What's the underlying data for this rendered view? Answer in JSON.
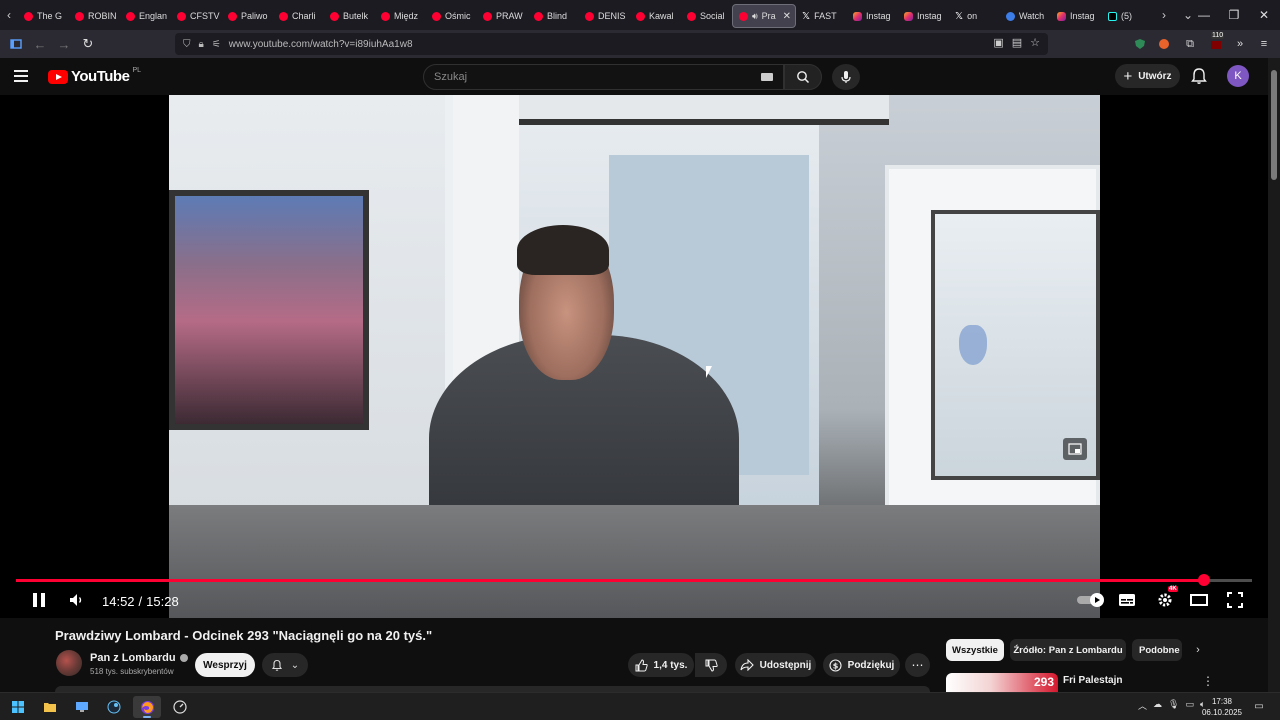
{
  "browser": {
    "tabs": [
      {
        "label": "The G",
        "icon": "youtube-icon"
      },
      {
        "label": "ROBIN",
        "icon": "youtube-icon"
      },
      {
        "label": "Englan",
        "icon": "youtube-icon"
      },
      {
        "label": "CFSTV",
        "icon": "youtube-icon"
      },
      {
        "label": "Paliwo",
        "icon": "youtube-icon"
      },
      {
        "label": "Charli",
        "icon": "youtube-icon"
      },
      {
        "label": "Butelk",
        "icon": "youtube-icon"
      },
      {
        "label": "Międz",
        "icon": "youtube-icon"
      },
      {
        "label": "Ośmic",
        "icon": "youtube-icon"
      },
      {
        "label": "PRAW",
        "icon": "youtube-icon"
      },
      {
        "label": "Blind",
        "icon": "youtube-icon"
      },
      {
        "label": "DENIS",
        "icon": "youtube-icon"
      },
      {
        "label": "Kawal",
        "icon": "youtube-icon"
      },
      {
        "label": "Social",
        "icon": "youtube-icon"
      },
      {
        "label": "Pra",
        "icon": "youtube-icon",
        "active": true
      },
      {
        "label": "FAST",
        "icon": "x-icon"
      },
      {
        "label": "Instag",
        "icon": "instagram-icon"
      },
      {
        "label": "Instag",
        "icon": "instagram-icon"
      },
      {
        "label": "on",
        "icon": "x-icon"
      },
      {
        "label": "Watch",
        "icon": "watch-icon"
      },
      {
        "label": "Instag",
        "icon": "instagram-icon"
      },
      {
        "label": "(5)",
        "icon": "tiktok-icon"
      }
    ],
    "url": "www.youtube.com/watch?v=i89iuhAa1w8",
    "extension_badge": "110"
  },
  "youtube": {
    "logo_text": "YouTube",
    "logo_country": "PL",
    "search_placeholder": "Szukaj",
    "create_label": "Utwórz",
    "avatar_letter": "K"
  },
  "player": {
    "current_time": "14:52",
    "duration": "15:28",
    "progress_fraction": 0.961,
    "quality_badge": "4K",
    "accent": "#ff0033"
  },
  "video": {
    "title": "Prawdziwy Lombard - Odcinek 293 \"Naciągnęli go na 20 tyś.\"",
    "channel_name": "Pan z Lombardu",
    "subscribers": "518 tys. subskrybentów",
    "join_label": "Wesprzyj",
    "likes": "1,4 tys.",
    "share_label": "Udostępnij",
    "thanks_label": "Podziękuj"
  },
  "sidebar": {
    "chips": [
      "Wszystkie",
      "Źródło: Pan z Lombardu",
      "Podobne"
    ],
    "recommended": {
      "title": "Fri Palestajn",
      "channel": "",
      "thumb_number": "293"
    }
  },
  "taskbar": {
    "time": "17:38",
    "date": "06.10.2025"
  }
}
